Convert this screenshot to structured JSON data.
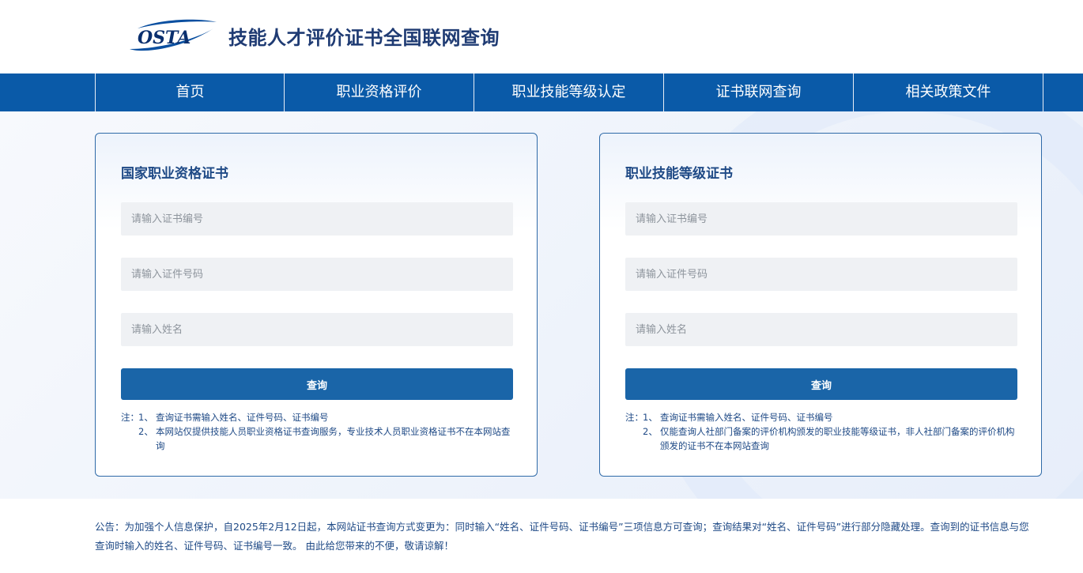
{
  "site": {
    "title": "技能人才评价证书全国联网查询",
    "logo_text": "OSTA"
  },
  "nav": {
    "items": [
      {
        "label": "首页"
      },
      {
        "label": "职业资格评价"
      },
      {
        "label": "职业技能等级认定"
      },
      {
        "label": "证书联网查询"
      },
      {
        "label": "相关政策文件"
      }
    ]
  },
  "panels": [
    {
      "title": "国家职业资格证书",
      "cert_no_placeholder": "请输入证书编号",
      "id_no_placeholder": "请输入证件号码",
      "name_placeholder": "请输入姓名",
      "button_label": "查询",
      "note_lead": "注：",
      "notes": [
        {
          "index": "1、",
          "text": "查询证书需输入姓名、证件号码、证书编号"
        },
        {
          "index": "2、",
          "text": "本网站仅提供技能人员职业资格证书查询服务，专业技术人员职业资格证书不在本网站查询"
        }
      ]
    },
    {
      "title": "职业技能等级证书",
      "cert_no_placeholder": "请输入证书编号",
      "id_no_placeholder": "请输入证件号码",
      "name_placeholder": "请输入姓名",
      "button_label": "查询",
      "note_lead": "注：",
      "notes": [
        {
          "index": "1、",
          "text": "查询证书需输入姓名、证件号码、证书编号"
        },
        {
          "index": "2、",
          "text": "仅能查询人社部门备案的评价机构颁发的职业技能等级证书，非人社部门备案的评价机构颁发的证书不在本网站查询"
        }
      ]
    }
  ],
  "announcement": "公告：为加强个人信息保护，自2025年2月12日起，本网站证书查询方式变更为：同时输入“姓名、证件号码、证书编号”三项信息方可查询；查询结果对“姓名、证件号码”进行部分隐藏处理。查询到的证书信息与您查询时输入的姓名、证件号码、证书编号一致。 由此给您带来的不便，敬请谅解！",
  "colors": {
    "nav_bg": "#0a5aa8",
    "button_bg": "#1a65a8",
    "title_text": "#1f3b73",
    "panel_border": "#2f6aa8"
  }
}
